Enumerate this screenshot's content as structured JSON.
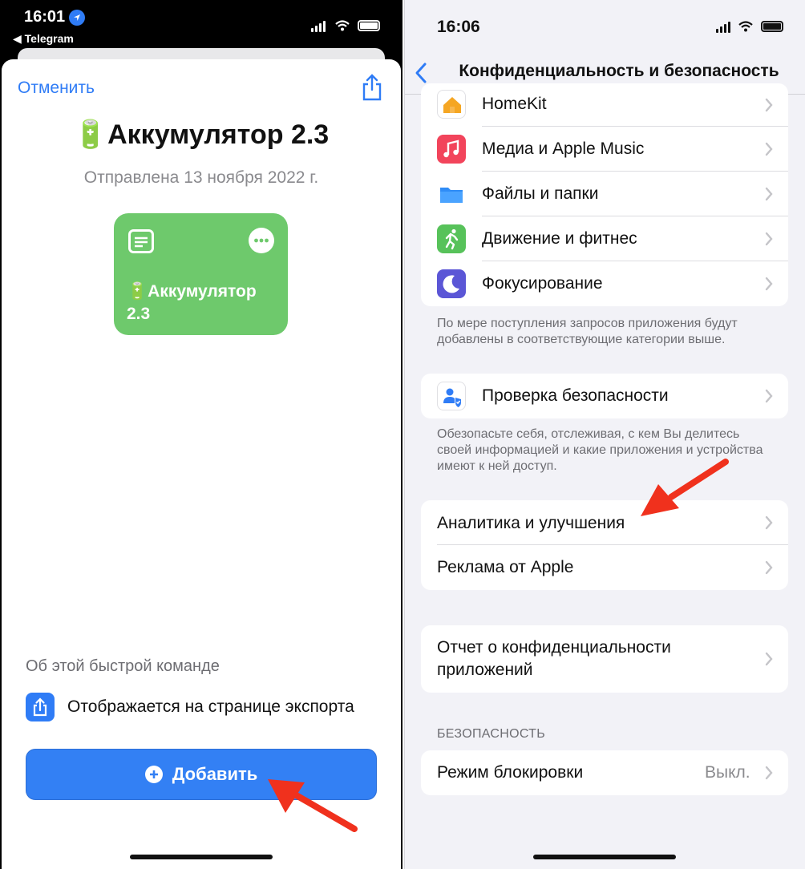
{
  "left": {
    "status_time": "16:01",
    "back_app": "◀ Telegram",
    "cancel_label": "Отменить",
    "title": "🔋Аккумулятор 2.3",
    "subtitle": "Отправлена 13 ноября 2022 г.",
    "tile_label": "🔋Аккумулятор 2.3",
    "about_heading": "Об этой быстрой команде",
    "export_text": "Отображается на странице экспорта",
    "add_button": "Добавить",
    "colors": {
      "accent": "#3380f4",
      "tile": "#6ec96c",
      "arrow": "#f0311d"
    }
  },
  "right": {
    "status_time": "16:06",
    "nav_title": "Конфиденциальность и безопасность",
    "apps_group": [
      {
        "label": "HomeKit",
        "icon": "home-icon",
        "color": "#ffffff"
      },
      {
        "label": "Медиа и Apple Music",
        "icon": "music-note-icon",
        "color": "#f2445b"
      },
      {
        "label": "Файлы и папки",
        "icon": "folder-icon",
        "color": "#ffffff"
      },
      {
        "label": "Движение и фитнес",
        "icon": "running-figure-icon",
        "color": "#57c25a"
      },
      {
        "label": "Фокусирование",
        "icon": "moon-icon",
        "color": "#5b56d6"
      }
    ],
    "apps_footer": "По мере поступления запросов приложения будут добавлены в соответствующие категории выше.",
    "safety_check": {
      "label": "Проверка безопасности",
      "icon": "person-shield-icon"
    },
    "safety_footer": "Обезопасьте себя, отслеживая, с кем Вы делитесь своей информацией и какие приложения и устройства имеют к ней доступ.",
    "analytics_group": [
      "Аналитика и улучшения",
      "Реклама от Apple"
    ],
    "report_label": "Отчет о конфиденциальности приложений",
    "security_header": "БЕЗОПАСНОСТЬ",
    "lockdown": {
      "label": "Режим блокировки",
      "value": "Выкл."
    }
  }
}
